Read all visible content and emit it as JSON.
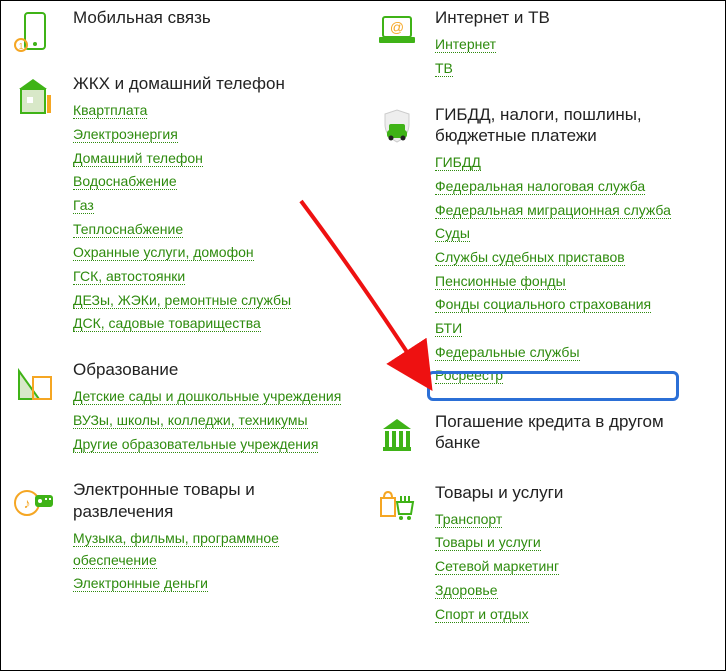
{
  "left": [
    {
      "title": "Мобильная связь",
      "icon": "phone-icon",
      "links": []
    },
    {
      "title": "ЖКХ и домашний телефон",
      "icon": "house-icon",
      "links": [
        "Квартплата",
        "Электроэнергия",
        "Домашний телефон",
        "Водоснабжение",
        "Газ",
        "Теплоснабжение",
        "Охранные услуги, домофон",
        "ГСК, автостоянки",
        "ДЕЗы, ЖЭКи, ремонтные службы",
        "ДСК, садовые товарищества"
      ]
    },
    {
      "title": "Образование",
      "icon": "education-icon",
      "links": [
        "Детские сады и дошкольные учреждения",
        "ВУЗы, школы, колледжи, техникумы",
        "Другие образовательные учреждения"
      ]
    },
    {
      "title": "Электронные товары и развлечения",
      "icon": "media-icon",
      "links": [
        "Музыка, фильмы, программное обеспечение",
        "Электронные деньги"
      ]
    }
  ],
  "right": [
    {
      "title": "Интернет и ТВ",
      "icon": "laptop-icon",
      "links": [
        "Интернет",
        "ТВ"
      ]
    },
    {
      "title": "ГИБДД, налоги, пошлины, бюджетные платежи",
      "icon": "gov-icon",
      "links": [
        "ГИБДД",
        "Федеральная налоговая служба",
        "Федеральная миграционная служба",
        "Суды",
        "Службы судебных приставов",
        "Пенсионные фонды",
        "Фонды социального страхования",
        "БТИ",
        "Федеральные службы",
        "Росреестр"
      ]
    },
    {
      "title": "Погашение кредита в другом банке",
      "icon": "bank-icon",
      "links": []
    },
    {
      "title": "Товары и услуги",
      "icon": "cart-icon",
      "links": [
        "Транспорт",
        "Товары и услуги",
        "Сетевой маркетинг",
        "Здоровье",
        "Спорт и отдых"
      ]
    }
  ],
  "annotation": {
    "highlighted_link": "Росреестр"
  }
}
